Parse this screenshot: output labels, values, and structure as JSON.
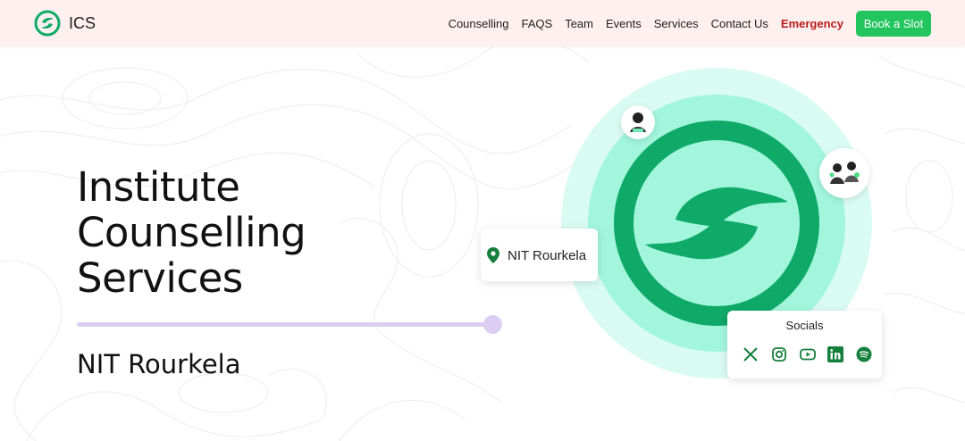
{
  "header": {
    "brand": "ICS",
    "nav": [
      {
        "label": "Counselling"
      },
      {
        "label": "FAQS"
      },
      {
        "label": "Team"
      },
      {
        "label": "Events"
      },
      {
        "label": "Services"
      },
      {
        "label": "Contact Us"
      },
      {
        "label": "Emergency"
      }
    ],
    "cta_label": "Book a Slot"
  },
  "hero": {
    "title_lines": [
      "Institute",
      "Counselling",
      "Services"
    ],
    "subtitle": "NIT Rourkela"
  },
  "location_card": {
    "label": "NIT Rourkela",
    "icon": "map-pin-icon"
  },
  "socials": {
    "title": "Socials",
    "icons": [
      "x-icon",
      "instagram-icon",
      "youtube-icon",
      "linkedin-icon",
      "spotify-icon"
    ]
  },
  "colors": {
    "brand_green": "#0fa968",
    "cta_green": "#22c55e",
    "emergency_red": "#b91c1c",
    "header_bg": "#fdf0ef",
    "circle_light": "#d9fbf1",
    "circle_mid": "#a2f6dc",
    "divider_lavender": "#dccdf2"
  }
}
